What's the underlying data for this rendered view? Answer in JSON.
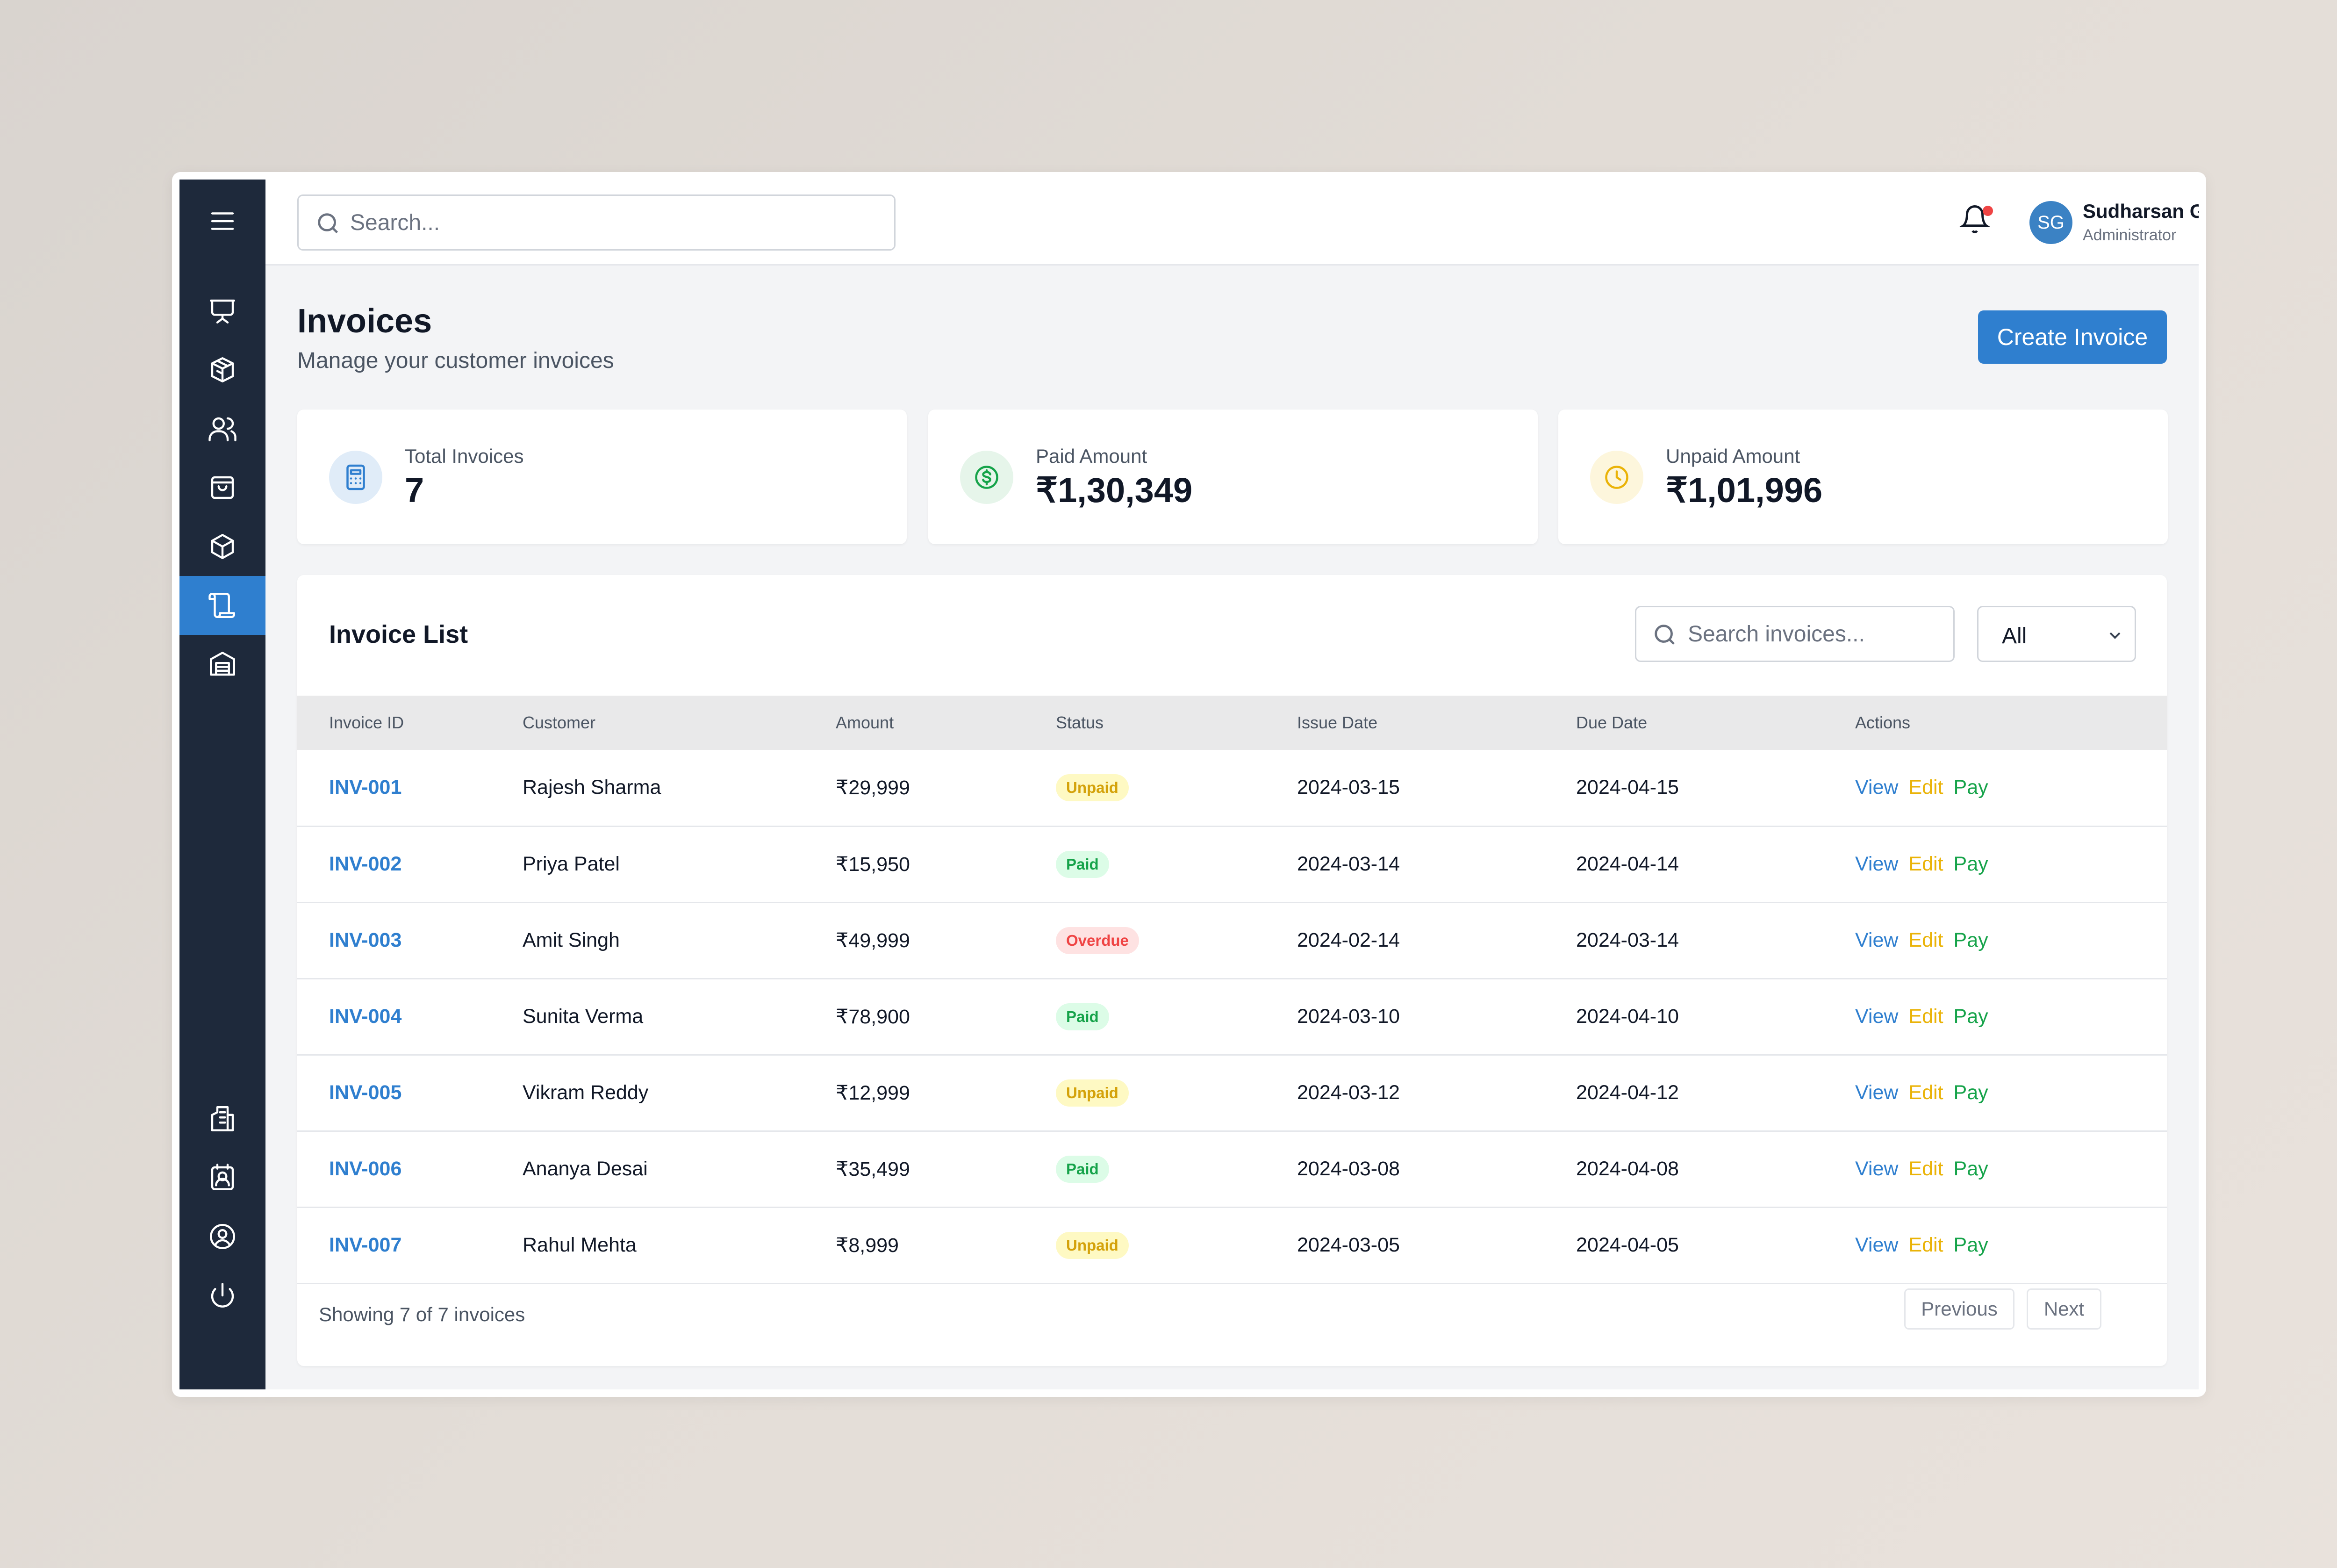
{
  "topbar": {
    "search_placeholder": "Search...",
    "user": {
      "initials": "SG",
      "name": "Sudharsan GS",
      "role": "Administrator"
    }
  },
  "header": {
    "title": "Invoices",
    "subtitle": "Manage your customer invoices",
    "create_label": "Create Invoice"
  },
  "stats": [
    {
      "label": "Total Invoices",
      "value": "7",
      "icon": "calculator-icon",
      "bg": "#e0ecf8",
      "color": "#2f7fcf"
    },
    {
      "label": "Paid Amount",
      "value": "₹1,30,349",
      "icon": "dollar-circle-icon",
      "bg": "#e6f5ea",
      "color": "#16a34a"
    },
    {
      "label": "Unpaid Amount",
      "value": "₹1,01,996",
      "icon": "clock-icon",
      "bg": "#fdf6dc",
      "color": "#eab308"
    }
  ],
  "invoice_list": {
    "title": "Invoice List",
    "search_placeholder": "Search invoices...",
    "filter_value": "All",
    "columns": [
      "Invoice ID",
      "Customer",
      "Amount",
      "Status",
      "Issue Date",
      "Due Date",
      "Actions"
    ],
    "actions": {
      "view": "View",
      "edit": "Edit",
      "pay": "Pay"
    },
    "rows": [
      {
        "id": "INV-001",
        "customer": "Rajesh Sharma",
        "amount": "₹29,999",
        "status": "Unpaid",
        "issue": "2024-03-15",
        "due": "2024-04-15"
      },
      {
        "id": "INV-002",
        "customer": "Priya Patel",
        "amount": "₹15,950",
        "status": "Paid",
        "issue": "2024-03-14",
        "due": "2024-04-14"
      },
      {
        "id": "INV-003",
        "customer": "Amit Singh",
        "amount": "₹49,999",
        "status": "Overdue",
        "issue": "2024-02-14",
        "due": "2024-03-14"
      },
      {
        "id": "INV-004",
        "customer": "Sunita Verma",
        "amount": "₹78,900",
        "status": "Paid",
        "issue": "2024-03-10",
        "due": "2024-04-10"
      },
      {
        "id": "INV-005",
        "customer": "Vikram Reddy",
        "amount": "₹12,999",
        "status": "Unpaid",
        "issue": "2024-03-12",
        "due": "2024-04-12"
      },
      {
        "id": "INV-006",
        "customer": "Ananya Desai",
        "amount": "₹35,499",
        "status": "Paid",
        "issue": "2024-03-08",
        "due": "2024-04-08"
      },
      {
        "id": "INV-007",
        "customer": "Rahul Mehta",
        "amount": "₹8,999",
        "status": "Unpaid",
        "issue": "2024-03-05",
        "due": "2024-04-05"
      }
    ],
    "footer": {
      "showing": "Showing 7 of 7 invoices",
      "previous": "Previous",
      "next": "Next"
    }
  },
  "sidebar": {
    "active": "invoices",
    "items": [
      {
        "name": "menu",
        "icon": "menu-icon"
      },
      {
        "name": "dashboard",
        "icon": "presentation-icon"
      },
      {
        "name": "products",
        "icon": "boxes-icon"
      },
      {
        "name": "customers",
        "icon": "users-icon"
      },
      {
        "name": "orders",
        "icon": "shopping-bag-icon"
      },
      {
        "name": "inventory",
        "icon": "package-icon"
      },
      {
        "name": "invoices",
        "icon": "scroll-icon"
      },
      {
        "name": "warehouse",
        "icon": "warehouse-icon"
      },
      {
        "name": "reports",
        "icon": "receipt-icon"
      },
      {
        "name": "contacts",
        "icon": "contact-icon"
      },
      {
        "name": "profile",
        "icon": "user-circle-icon"
      },
      {
        "name": "logout",
        "icon": "power-icon"
      }
    ]
  }
}
